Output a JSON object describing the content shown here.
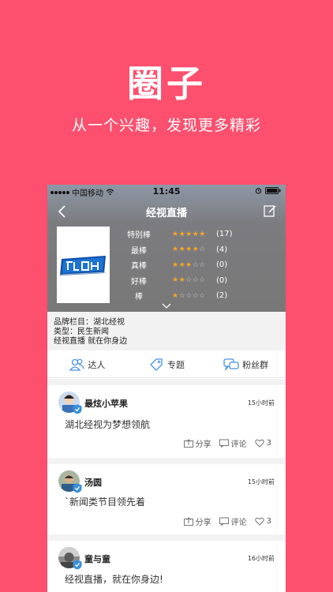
{
  "hero": {
    "title": "圈子",
    "subtitle": "从一个兴趣，发现更多精彩"
  },
  "status_bar": {
    "carrier": "中国移动",
    "time": "11:45"
  },
  "nav": {
    "title": "经视直播"
  },
  "logo": {
    "alt_text": "经视直播"
  },
  "ratings": [
    {
      "label": "特别棒",
      "stars": 5,
      "count": "(17)"
    },
    {
      "label": "最棒",
      "stars": 4,
      "count": "(4)"
    },
    {
      "label": "真棒",
      "stars": 3,
      "count": "(0)"
    },
    {
      "label": "好棒",
      "stars": 2,
      "count": "(0)"
    },
    {
      "label": "棒",
      "stars": 1,
      "count": "(2)"
    }
  ],
  "info": {
    "brand": "品牌栏目：湖北经视",
    "type": "类型：民生新闻",
    "slogan": "经视直播 就在你身边"
  },
  "tabs": [
    {
      "label": "达人",
      "icon": "people-icon"
    },
    {
      "label": "专题",
      "icon": "tag-icon"
    },
    {
      "label": "粉丝群",
      "icon": "chat-bubbles-icon"
    }
  ],
  "posts": [
    {
      "user": "最炫小苹果",
      "time": "15小时前",
      "content": "湖北经视为梦想领航",
      "share": "分享",
      "comment": "评论",
      "likes": "3"
    },
    {
      "user": "汤圆",
      "time": "15小时前",
      "content": "`新闻类节目领先着",
      "share": "分享",
      "comment": "评论",
      "likes": "3"
    },
    {
      "user": "童与童",
      "time": "16小时前",
      "content": "经视直播，就在你身边!"
    }
  ],
  "colors": {
    "brand_background": "#fd4f6e",
    "star": "#f6a623",
    "star_empty": "#c8c8c8",
    "tab_icon": "#4a90e2"
  }
}
